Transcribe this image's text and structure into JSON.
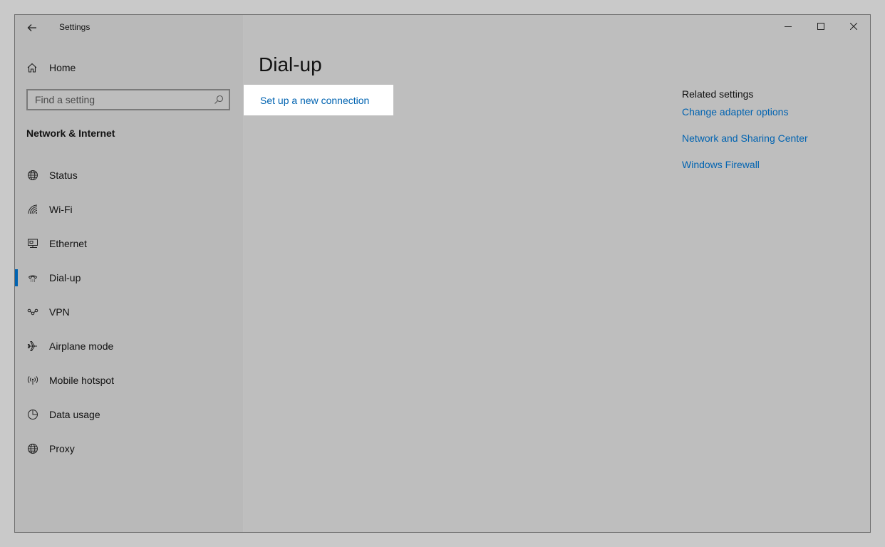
{
  "window": {
    "title": "Settings"
  },
  "sidebar": {
    "home_label": "Home",
    "search_placeholder": "Find a setting",
    "section_title": "Network & Internet",
    "items": [
      {
        "label": "Status",
        "icon": "globe-status-icon"
      },
      {
        "label": "Wi-Fi",
        "icon": "wifi-icon"
      },
      {
        "label": "Ethernet",
        "icon": "ethernet-icon"
      },
      {
        "label": "Dial-up",
        "icon": "dialup-icon",
        "active": true
      },
      {
        "label": "VPN",
        "icon": "vpn-icon"
      },
      {
        "label": "Airplane mode",
        "icon": "airplane-icon"
      },
      {
        "label": "Mobile hotspot",
        "icon": "hotspot-icon"
      },
      {
        "label": "Data usage",
        "icon": "data-usage-icon"
      },
      {
        "label": "Proxy",
        "icon": "globe-icon"
      }
    ]
  },
  "main": {
    "title": "Dial-up",
    "setup_link": "Set up a new connection",
    "related": {
      "heading": "Related settings",
      "links": [
        "Change adapter options",
        "Network and Sharing Center",
        "Windows Firewall"
      ]
    }
  },
  "colors": {
    "accent": "#0063b1",
    "highlight_card": "#ffffff"
  }
}
